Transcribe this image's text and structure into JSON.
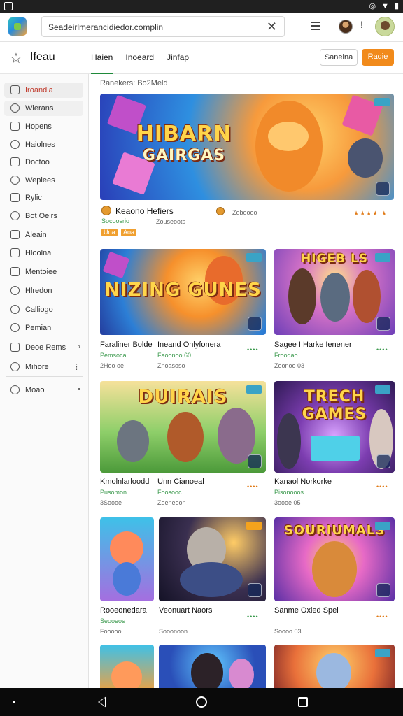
{
  "browser": {
    "url": "Seadeirlmerancidiedor.complin"
  },
  "header": {
    "title": "Ifeau",
    "tabs": [
      "Haien",
      "Inoeard",
      "Jinfap"
    ],
    "btn_secondary": "Saneina",
    "btn_primary": "Radie"
  },
  "sidebar": {
    "items": [
      {
        "label": "Iroandia",
        "icon": "mail-icon"
      },
      {
        "label": "Wierans",
        "icon": "search-icon"
      },
      {
        "label": "Hopens",
        "icon": "calendar-icon"
      },
      {
        "label": "Haiolnes",
        "icon": "check-circle-icon"
      },
      {
        "label": "Doctoo",
        "icon": "message-icon"
      },
      {
        "label": "Weplees",
        "icon": "globe-icon"
      },
      {
        "label": "Rylic",
        "icon": "square-icon"
      },
      {
        "label": "Bot Oeirs",
        "icon": "pen-icon"
      },
      {
        "label": "Aleain",
        "icon": "note-icon"
      },
      {
        "label": "Hloolna",
        "icon": "document-icon"
      },
      {
        "label": "Mentoiee",
        "icon": "image-icon"
      },
      {
        "label": "Hlredon",
        "icon": "clock-icon"
      },
      {
        "label": "Calliogo",
        "icon": "phone-icon"
      },
      {
        "label": "Pemian",
        "icon": "chat-icon"
      },
      {
        "label": "Deoe Rems",
        "icon": "grid-icon"
      },
      {
        "label": "Mihore",
        "icon": "settings-icon"
      },
      {
        "label": "Moao",
        "icon": "home-icon"
      }
    ]
  },
  "main": {
    "section_label": "Ranekers: Bo2Meld",
    "featured": {
      "art_title_1": "HIBARN",
      "art_title_2": "GAIRGAS",
      "title": "Keaono Hefiers",
      "sub": "Socoosrio",
      "tags": [
        "Uoa",
        "Aoa"
      ],
      "meta_author": "Zoboooo",
      "meta": "Zouseoots",
      "rating": "★★★★ ★"
    },
    "cards": [
      {
        "art": "NIZING GUNES",
        "title": "Faraliner Bolde",
        "sub": "Pemsoca",
        "meta": "2Hoo oe"
      },
      {
        "art": "Ineand Onlyfonera",
        "title": "Ineand Onlyfonera",
        "sub": "Faoonoo 60",
        "meta": "Znoasoso"
      },
      {
        "art": "HIGEB LS",
        "title": "Sagee I Harke Ienener",
        "sub": "Froodao",
        "meta": "Zoonoo 03"
      },
      {
        "art": "DUIRAIS",
        "title": "Kmolnlarloodd",
        "sub": "Pusomon",
        "meta": "3Soooe"
      },
      {
        "art": "",
        "title": "Unn Cianoeal",
        "sub": "Foosooc",
        "meta": "Zoeneoon"
      },
      {
        "art": "TRECH GAMES",
        "title": "Kanaol Norkorke",
        "sub": "Pisonooos",
        "meta": "3oooe 05"
      },
      {
        "art": "",
        "title": "Rooeonedara",
        "sub": "Seooeos",
        "meta": "Fooooo"
      },
      {
        "art": "",
        "title": "Veonuart Naors",
        "sub": "",
        "meta": "Sooonoon"
      },
      {
        "art": "SOURIUMALS",
        "title": "Sanme Oxied Spel",
        "sub": "",
        "meta": "Soooo 03"
      }
    ],
    "ratings": [
      "••••",
      "••••",
      "••••",
      "••••",
      "••••",
      "••••",
      "••••",
      "••••",
      "••••"
    ]
  }
}
